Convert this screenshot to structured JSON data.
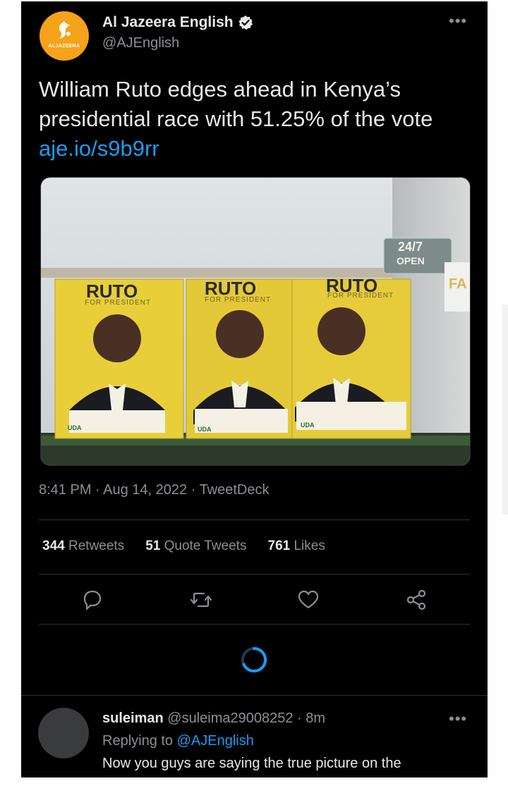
{
  "tweet": {
    "author_name": "Al Jazeera English",
    "author_handle": "@AJEnglish",
    "avatar_brand": "ALJAZEERA",
    "more_label": "•••",
    "text": "William Ruto edges ahead in Kenya’s presidential race with 51.25% of the vote ",
    "link_text": "aje.io/s9b9rr",
    "timestamp": "8:41 PM · Aug 14, 2022 · ",
    "source": "TweetDeck"
  },
  "media": {
    "poster_headline": "RUTO",
    "poster_tagline": "FOR PRESIDENT",
    "poster_party": "UDA",
    "sign_top": "24/7",
    "sign_bottom": "OPEN",
    "sign_side": "FA"
  },
  "stats": [
    {
      "value": "344",
      "label": "Retweets"
    },
    {
      "value": "51",
      "label": "Quote Tweets"
    },
    {
      "value": "761",
      "label": "Likes"
    }
  ],
  "actions": [
    "reply-icon",
    "retweet-icon",
    "like-icon",
    "share-icon"
  ],
  "reply": {
    "name": "suleiman",
    "handle_time": " @suleima29008252 · 8m",
    "replying_prefix": "Replying to ",
    "replying_handle": "@AJEnglish",
    "text": "Now you guys are saying the true picture on the",
    "more_label": "•••"
  },
  "colors": {
    "background": "#000000",
    "text": "#e7e9ea",
    "muted": "#8b8f93",
    "link": "#1d9bf0",
    "avatar_orange": "#f6a21a",
    "poster_yellow": "#e8cf3a"
  }
}
